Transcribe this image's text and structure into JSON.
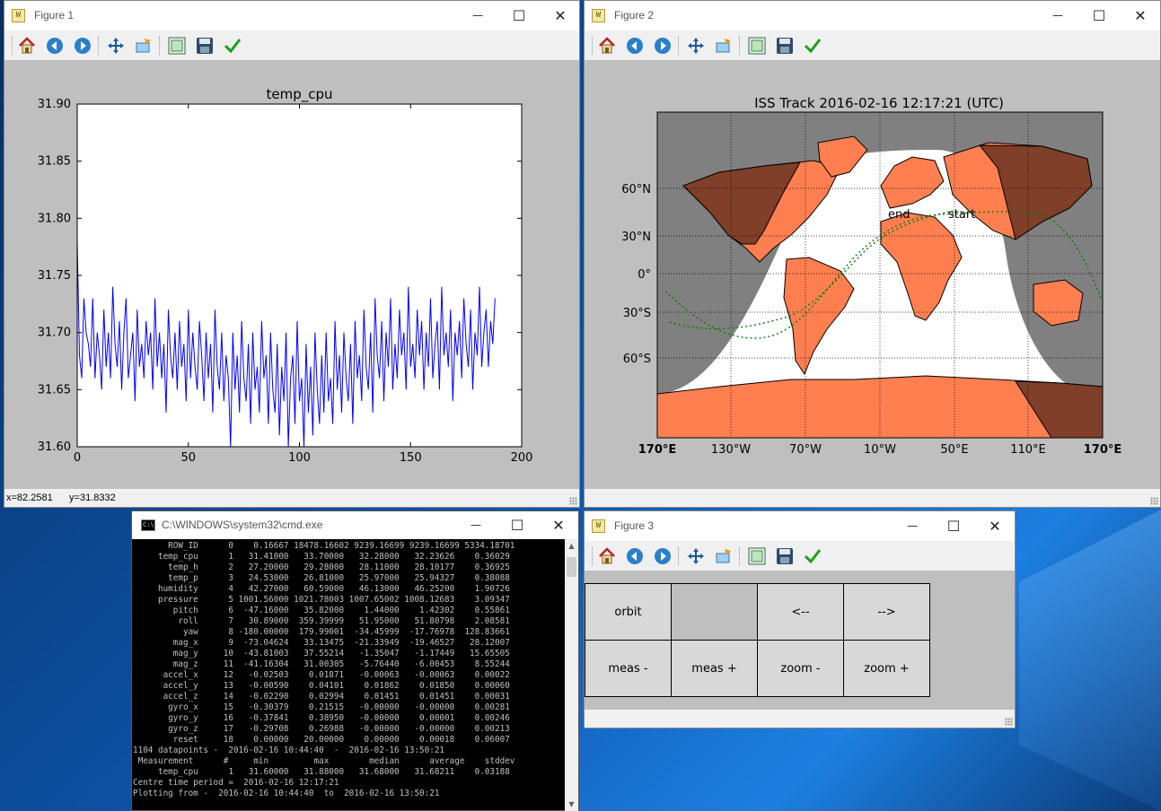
{
  "figure1": {
    "title": "Figure 1",
    "plot_title": "temp_cpu",
    "status": {
      "x": "x=82.2581",
      "y": "y=31.8332"
    }
  },
  "figure2": {
    "title": "Figure 2",
    "plot_title": "ISS Track 2016-02-16 12:17:21 (UTC)",
    "lat_labels": [
      "60°N",
      "30°N",
      "0°",
      "30°S",
      "60°S"
    ],
    "lon_labels": [
      "170°E",
      "130°W",
      "70°W",
      "10°W",
      "50°E",
      "110°E",
      "170°E"
    ],
    "annotations": {
      "end": "end",
      "start": "start"
    },
    "colors": {
      "ocean_night": "#808080",
      "ocean_day": "#ffffff",
      "land_day": "#ff7f50",
      "land_night": "#7f3f28",
      "track": "#008000"
    }
  },
  "figure3": {
    "title": "Figure 3",
    "buttons": {
      "orbit": "orbit",
      "prev": "<--",
      "next": "-->",
      "meas_minus": "meas -",
      "meas_plus": "meas +",
      "zoom_minus": "zoom -",
      "zoom_plus": "zoom +"
    }
  },
  "toolbar": {
    "icons": [
      "home-icon",
      "back-arrow-icon",
      "forward-arrow-icon",
      "pan-icon",
      "zoom-rect-icon",
      "subplots-icon",
      "save-icon",
      "edit-check-icon"
    ]
  },
  "window_controls": {
    "minimize": "—",
    "maximize": "☐",
    "close": "✕"
  },
  "cmd": {
    "title": "C:\\WINDOWS\\system32\\cmd.exe",
    "lines": [
      "       ROW_ID      0    0.16667 18478.16602 9239.16699 9239.16699 5334.18701",
      "     temp_cpu      1   31.41000   33.70000   32.28000   32.23626    0.36029",
      "       temp_h      2   27.20000   29.28000   28.11000   28.10177    0.36925",
      "       temp_p      3   24.53000   26.81000   25.97000   25.94327    0.38088",
      "     humidity      4   42.27000   60.59000   46.13000   46.25200    1.90726",
      "     pressure      5 1001.56000 1021.78003 1007.65002 1008.12683    3.09347",
      "        pitch      6  -47.16000   35.82000    1.44000    1.42302    0.55861",
      "         roll      7   30.89000  359.39999   51.95000   51.80798    2.08581",
      "          yaw      8 -180.00000  179.99001  -34.45999  -17.76978  128.83661",
      "        mag_x      9  -73.04624   33.13475  -21.33949  -19.46527   28.12007",
      "        mag_y     10  -43.81003   37.55214   -1.35047   -1.17449   15.65505",
      "        mag_z     11  -41.16304   31.00305   -5.76440   -6.00453    8.55244",
      "      accel_x     12   -0.02503    0.01871   -0.00063   -0.00063    0.00022",
      "      accel_y     13   -0.00590    0.04101    0.01862    0.01850    0.00060",
      "      accel_z     14   -0.02290    0.02994    0.01451    0.01451    0.00031",
      "       gyro_x     15   -0.30379    0.21515   -0.00000   -0.00000    0.00281",
      "       gyro_y     16   -0.37841    0.38950   -0.00000    0.00001    0.00246",
      "       gyro_z     17   -0.29708    0.26988   -0.00000   -0.00000    0.00213",
      "        reset     18    0.00000   20.00000    0.00000    0.00018    0.06007",
      "1104 datapoints -  2016-02-16 10:44:40  -  2016-02-16 13:50:21",
      " Measurement      #     min         max        median      average    stddev",
      "     temp_cpu      1   31.60000   31.88000   31.68000   31.68211    0.03188",
      "Centre time period =  2016-02-16 12:17:21",
      "Plotting from -  2016-02-16 10:44:40  to  2016-02-16 13:50:21"
    ]
  },
  "chart_data": {
    "type": "line",
    "title": "temp_cpu",
    "xlim": [
      0,
      200
    ],
    "ylim": [
      31.6,
      31.9
    ],
    "xticks": [
      "0",
      "50",
      "100",
      "150",
      "200"
    ],
    "yticks": [
      "31.90",
      "31.85",
      "31.80",
      "31.75",
      "31.70",
      "31.65",
      "31.60"
    ],
    "series": [
      {
        "color": "#0000ff",
        "x_start": 0,
        "x_step": 1,
        "values": [
          31.78,
          31.68,
          31.66,
          31.73,
          31.7,
          31.69,
          31.67,
          31.73,
          31.66,
          31.7,
          31.68,
          31.65,
          31.72,
          31.67,
          31.7,
          31.66,
          31.74,
          31.69,
          31.67,
          31.71,
          31.65,
          31.7,
          31.73,
          31.66,
          31.68,
          31.7,
          31.64,
          31.72,
          31.67,
          31.69,
          31.66,
          31.71,
          31.68,
          31.7,
          31.65,
          31.73,
          31.67,
          31.7,
          31.66,
          31.69,
          31.63,
          31.72,
          31.68,
          31.66,
          31.7,
          31.65,
          31.71,
          31.67,
          31.69,
          31.64,
          31.72,
          31.66,
          31.7,
          31.67,
          31.65,
          31.71,
          31.68,
          31.64,
          31.7,
          31.66,
          31.69,
          31.63,
          31.72,
          31.67,
          31.65,
          31.7,
          31.64,
          31.68,
          31.66,
          31.6,
          31.7,
          31.65,
          31.68,
          31.63,
          31.71,
          31.66,
          31.64,
          31.69,
          31.62,
          31.7,
          31.65,
          31.67,
          31.63,
          31.71,
          31.66,
          31.68,
          31.62,
          31.7,
          31.65,
          31.63,
          31.69,
          31.61,
          31.67,
          31.64,
          31.7,
          31.6,
          31.66,
          31.68,
          31.62,
          31.71,
          31.64,
          31.66,
          31.6,
          31.69,
          31.63,
          31.67,
          31.61,
          31.7,
          31.65,
          31.62,
          31.68,
          31.63,
          31.7,
          31.64,
          31.66,
          31.62,
          31.71,
          31.65,
          31.68,
          31.63,
          31.7,
          31.66,
          31.64,
          31.69,
          31.62,
          31.71,
          31.66,
          31.68,
          31.64,
          31.72,
          31.67,
          31.65,
          31.7,
          31.63,
          31.73,
          31.68,
          31.66,
          31.71,
          31.64,
          31.7,
          31.67,
          31.73,
          31.65,
          31.69,
          31.66,
          31.72,
          31.68,
          31.7,
          31.65,
          31.74,
          31.67,
          31.69,
          31.66,
          31.72,
          31.68,
          31.71,
          31.65,
          31.7,
          31.67,
          31.73,
          31.66,
          31.69,
          31.71,
          31.65,
          31.74,
          31.68,
          31.7,
          31.67,
          31.72,
          31.64,
          31.7,
          31.68,
          31.71,
          31.66,
          31.73,
          31.69,
          31.67,
          31.72,
          31.65,
          31.7,
          31.68,
          31.74,
          31.67,
          31.7,
          31.72,
          31.67,
          31.71,
          31.69,
          31.73
        ]
      }
    ]
  }
}
